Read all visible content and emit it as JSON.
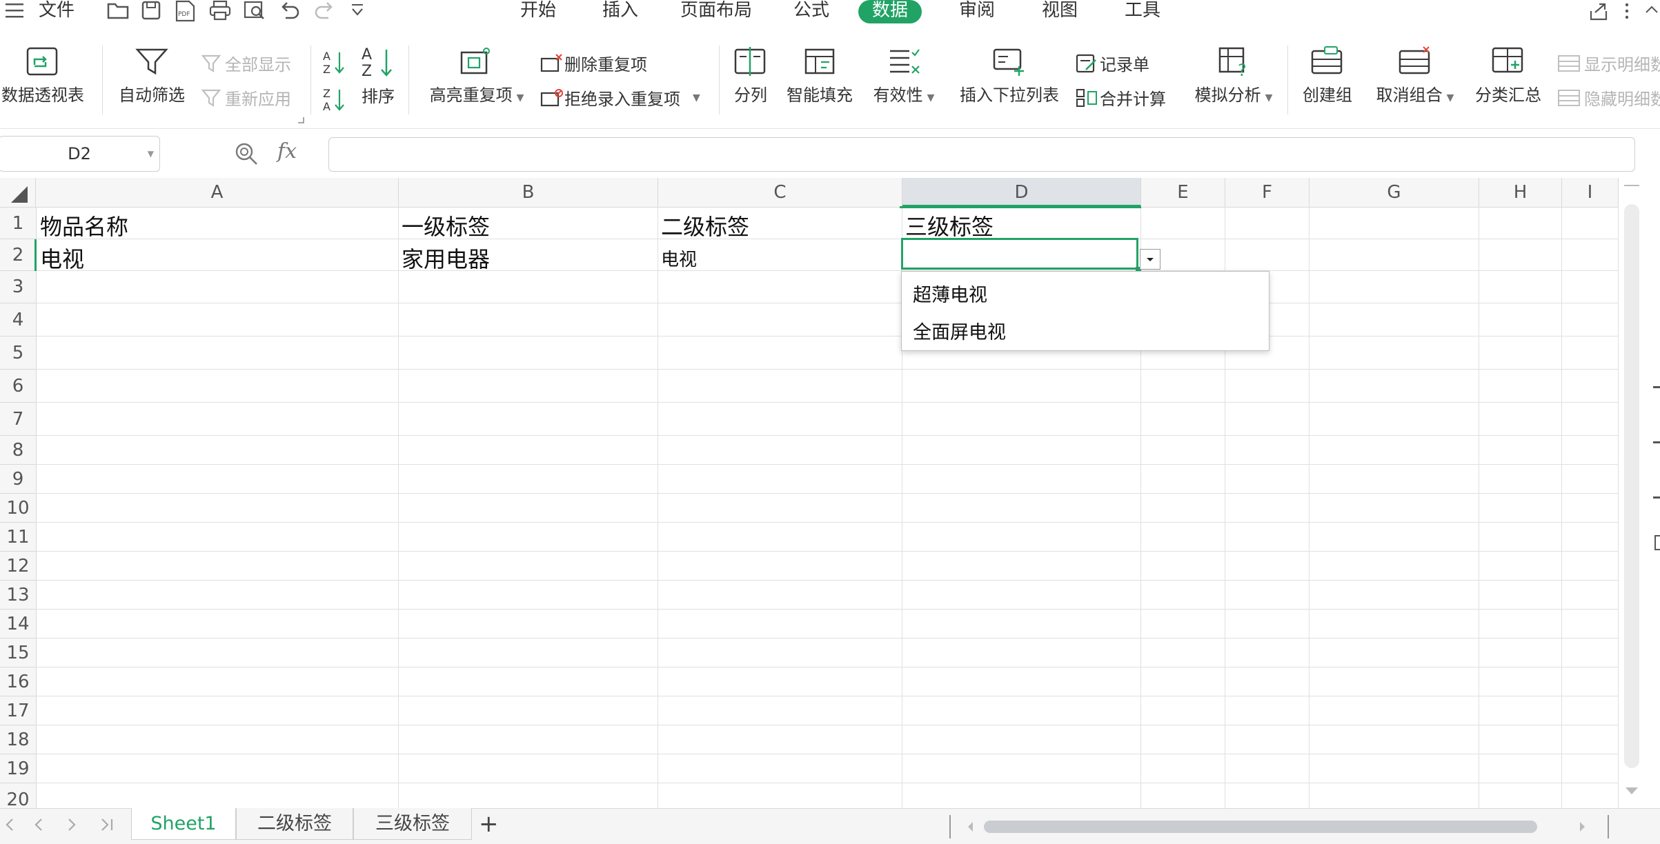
{
  "topbar": {
    "file_label": "文件",
    "tabs": [
      {
        "label": "开始",
        "active": false
      },
      {
        "label": "插入",
        "active": false
      },
      {
        "label": "页面布局",
        "active": false
      },
      {
        "label": "公式",
        "active": false
      },
      {
        "label": "数据",
        "active": true
      },
      {
        "label": "审阅",
        "active": false
      },
      {
        "label": "视图",
        "active": false
      },
      {
        "label": "工具",
        "active": false
      }
    ],
    "pdf_icon_text": "PDF"
  },
  "ribbon": {
    "pivot_table": "数据透视表",
    "auto_filter": "自动筛选",
    "show_all": "全部显示",
    "reapply": "重新应用",
    "sort": "排序",
    "highlight_duplicates": "高亮重复项",
    "remove_duplicates": "删除重复项",
    "reject_duplicates": "拒绝录入重复项",
    "split_column": "分列",
    "smart_fill": "智能填充",
    "validity": "有效性",
    "insert_dropdown": "插入下拉列表",
    "record_form": "记录单",
    "consolidate": "合并计算",
    "what_if": "模拟分析",
    "group": "创建组",
    "ungroup": "取消组合",
    "subtotal": "分类汇总",
    "show_detail": "显示明细数据",
    "hide_detail": "隐藏明细数据"
  },
  "formula_bar": {
    "name_box": "D2",
    "fx": "fx",
    "value": ""
  },
  "grid": {
    "columns": [
      "A",
      "B",
      "C",
      "D",
      "E",
      "F",
      "G",
      "H",
      "I"
    ],
    "selected_column": "D",
    "rows": [
      "1",
      "2",
      "3",
      "4",
      "5",
      "6",
      "7",
      "8",
      "9",
      "10",
      "11",
      "12",
      "13",
      "14",
      "15",
      "16",
      "17",
      "18",
      "19",
      "20"
    ],
    "cells": {
      "A1": "物品名称",
      "B1": "一级标签",
      "C1": "二级标签",
      "D1": "三级标签",
      "A2": "电视",
      "B2": "家用电器",
      "C2": "电视"
    },
    "selected_cell": "D2"
  },
  "dropdown": {
    "options": [
      "超薄电视",
      "全面屏电视"
    ]
  },
  "sheets": {
    "tabs": [
      {
        "label": "Sheet1",
        "active": true
      },
      {
        "label": "二级标签",
        "active": false
      },
      {
        "label": "三级标签",
        "active": false
      }
    ],
    "add_label": "+"
  },
  "colors": {
    "accent": "#21a366"
  }
}
